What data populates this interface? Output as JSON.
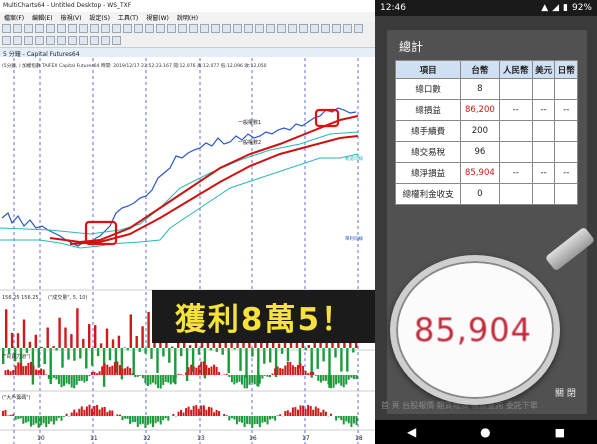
{
  "left_window": {
    "title": "MultiCharts64 - Untitled Desktop - WS_TXF",
    "menu": [
      "檔案(F)",
      "編輯(E)",
      "檢視(V)",
      "設定(S)",
      "工具(T)",
      "視窗(W)",
      "說明(H)"
    ],
    "chart_tab": "5 分鐘 - Capital Futures64",
    "info_line": "(5分鐘,  ) 加權指數   TAIFEX  Capital Futures64   時間: 2019/12/17  23:52:23.167  開:12,076  高:12,077  低:12,096  收:12,050",
    "line_labels": {
      "ma1": "一般權數1",
      "ma2": "一般權數2",
      "right_label1": "軌道均線",
      "right_label2": "單利均線"
    },
    "volume_label": "(\"成交量\", 5, 10)",
    "price_readout": "156.25 156.25",
    "indicator1_label": "(\"買賣力道\")",
    "indicator2_label": "(\"大戶籌碼\")",
    "x_ticks": [
      "10",
      "11",
      "12",
      "13",
      "16",
      "17",
      "18"
    ],
    "banner": "獲利8萬5！"
  },
  "phone": {
    "status_time": "12:46",
    "battery": "92%",
    "panel_title": "總計",
    "table": {
      "headers": [
        "項目",
        "台幣",
        "人民幣",
        "美元",
        "日幣"
      ],
      "rows": [
        {
          "label": "總口數",
          "twd": "8",
          "cny": "",
          "usd": "",
          "jpy": "",
          "red": false
        },
        {
          "label": "總損益",
          "twd": "86,200",
          "cny": "--",
          "usd": "--",
          "jpy": "--",
          "red": true
        },
        {
          "label": "總手續費",
          "twd": "200",
          "cny": "",
          "usd": "",
          "jpy": "",
          "red": false
        },
        {
          "label": "總交易稅",
          "twd": "96",
          "cny": "",
          "usd": "",
          "jpy": "",
          "red": false
        },
        {
          "label": "總淨損益",
          "twd": "85,904",
          "cny": "--",
          "usd": "--",
          "jpy": "--",
          "red": true
        },
        {
          "label": "總權利金收支",
          "twd": "0",
          "cny": "",
          "usd": "",
          "jpy": "",
          "red": false
        }
      ]
    },
    "close_label": "關 閉",
    "magnified_value": "85,904",
    "ghost_nav": "首 頁  台股報價  期貨報價  帳務查詢  委託下單"
  }
}
